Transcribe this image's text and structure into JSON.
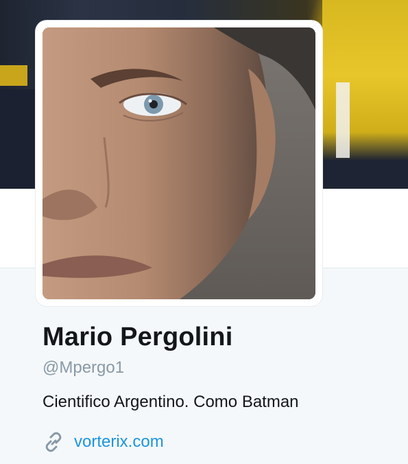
{
  "profile": {
    "name": "Mario Pergolini",
    "handle": "@Mpergo1",
    "bio": "Cientifico Argentino. Como Batman",
    "website": "vorterix.com",
    "link_icon": "link-icon"
  },
  "colors": {
    "name_text": "#14171a",
    "handle_text": "#8899a6",
    "link": "#1b95e0",
    "profile_background": "#f5f8fa"
  }
}
